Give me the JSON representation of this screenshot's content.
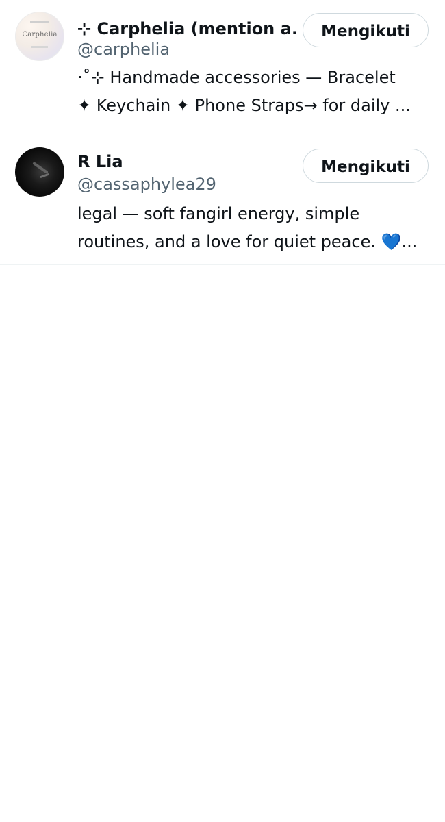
{
  "users": [
    {
      "display_name": "⊹ Carphelia (mention a...",
      "handle": "@carphelia",
      "avatar_text": "Carphelia",
      "bio_line_1": "·˚⊹ Handmade accessories — Bracelet",
      "bio_line_2": "✦ Keychain ✦ Phone Straps→ for daily ...",
      "follow_label": "Mengikuti"
    },
    {
      "display_name": "R Lia",
      "handle": "@cassaphylea29",
      "bio_line_1": "legal — soft fangirl energy, simple",
      "bio_line_2": "routines, and a love for quiet peace. 💙...",
      "follow_label": "Mengikuti"
    }
  ]
}
